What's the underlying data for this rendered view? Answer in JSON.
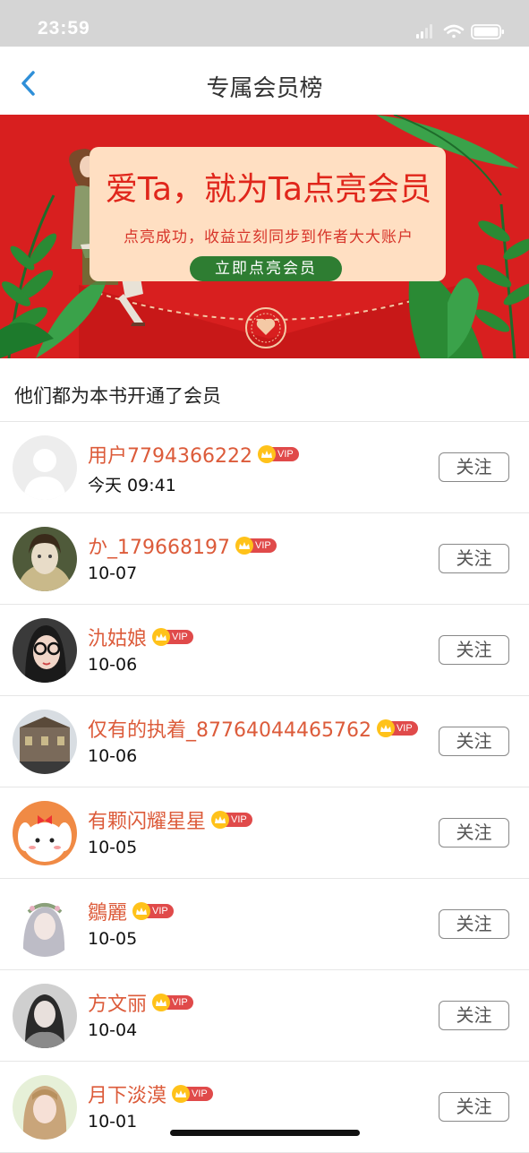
{
  "status_bar": {
    "time": "23:59"
  },
  "navbar": {
    "title": "专属会员榜"
  },
  "banner": {
    "title": "爱Ta，就为Ta点亮会员",
    "subtitle": "点亮成功，收益立刻同步到作者大大账户",
    "button_label": "立即点亮会员"
  },
  "section": {
    "title": "他们都为本书开通了会员"
  },
  "vip_label": "VIP",
  "follow_label": "关注",
  "members": [
    {
      "name": "用户7794366222",
      "date": "今天 09:41"
    },
    {
      "name": "か_179668197",
      "date": "10-07"
    },
    {
      "name": "氿姑娘",
      "date": "10-06"
    },
    {
      "name": "仅有的执着_87764044465762",
      "date": "10-06"
    },
    {
      "name": "有颗闪耀星星",
      "date": "10-05"
    },
    {
      "name": "鶵麗",
      "date": "10-05"
    },
    {
      "name": "方文丽",
      "date": "10-04"
    },
    {
      "name": "月下淡漠",
      "date": "10-01"
    }
  ],
  "colors": {
    "accent_blue": "#2f8fd8",
    "banner_red": "#d81f1f",
    "name_orange": "#dc5b3a",
    "vip_red": "#e04a4a",
    "crown_yellow": "#ffc21a"
  }
}
